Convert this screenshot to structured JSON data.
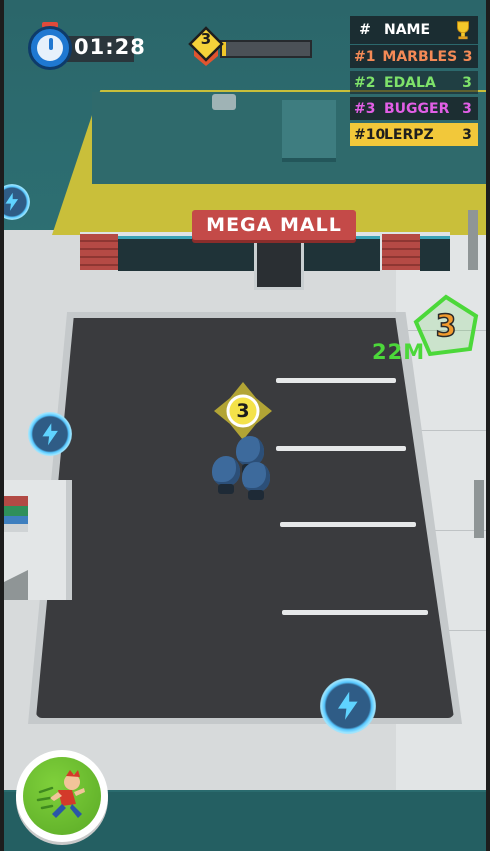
{
  "hud": {
    "timer": "01:28",
    "level": "3",
    "level_progress": 0.05
  },
  "leaderboard": {
    "header_hash": "#",
    "header_name": "NAME",
    "rows": [
      {
        "rank": "#1",
        "name": "MARBLES",
        "score": "3",
        "color": "#f48a56"
      },
      {
        "rank": "#2",
        "name": "EDALA",
        "score": "3",
        "color": "#7ee26a"
      },
      {
        "rank": "#3",
        "name": "BUGGER",
        "score": "3",
        "color": "#e25fe6"
      },
      {
        "rank": "#10",
        "name": "LERPZ",
        "score": "3",
        "color": "#1e1e1e"
      }
    ]
  },
  "scene": {
    "mall_sign": "MEGA MALL",
    "squad_count": "3",
    "rival_count": "3",
    "rival_distance": "22M",
    "rival_color": "#4cd83a"
  },
  "controls": {
    "sprint_icon": "sprinting-runner-icon"
  }
}
